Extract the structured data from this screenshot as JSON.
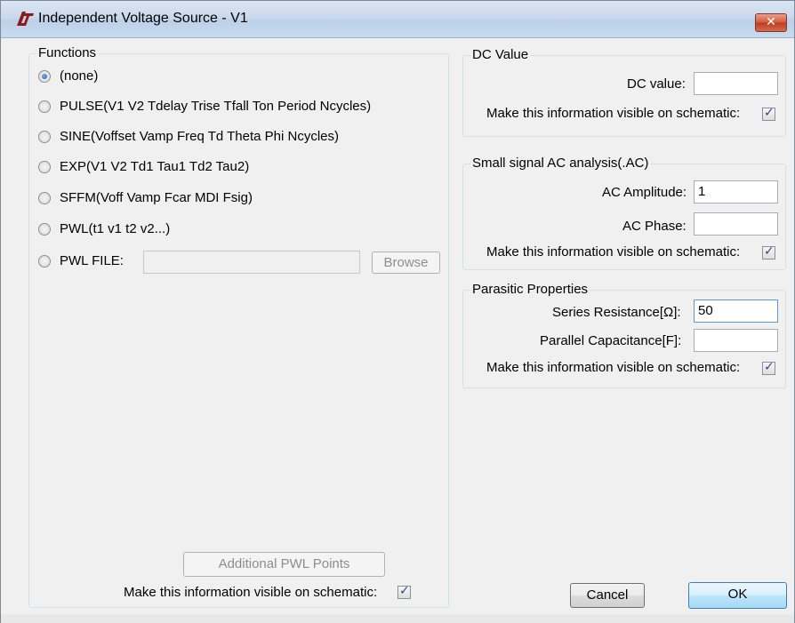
{
  "window": {
    "title": "Independent Voltage Source - V1",
    "close_label": "✕"
  },
  "functions": {
    "legend": "Functions",
    "options": [
      {
        "label": "(none)",
        "checked": true
      },
      {
        "label": "PULSE(V1 V2 Tdelay Trise Tfall Ton Period Ncycles)",
        "checked": false
      },
      {
        "label": "SINE(Voffset Vamp Freq Td Theta Phi Ncycles)",
        "checked": false
      },
      {
        "label": "EXP(V1 V2 Td1 Tau1 Td2 Tau2)",
        "checked": false
      },
      {
        "label": "SFFM(Voff Vamp Fcar MDI Fsig)",
        "checked": false
      },
      {
        "label": "PWL(t1 v1 t2 v2...)",
        "checked": false
      },
      {
        "label": "PWL FILE:",
        "checked": false
      }
    ],
    "pwl_file_value": "",
    "browse_label": "Browse",
    "additional_pwl_label": "Additional PWL Points",
    "visible_label": "Make this information visible on schematic:",
    "visible_checked": true
  },
  "dc": {
    "legend": "DC Value",
    "value_label": "DC value:",
    "value": "",
    "visible_label": "Make this information visible on schematic:",
    "visible_checked": true
  },
  "ac": {
    "legend": "Small signal AC analysis(.AC)",
    "amplitude_label": "AC Amplitude:",
    "amplitude": "1",
    "phase_label": "AC Phase:",
    "phase": "",
    "visible_label": "Make this information visible on schematic:",
    "visible_checked": true
  },
  "parasitic": {
    "legend": "Parasitic Properties",
    "series_label": "Series Resistance[Ω]:",
    "series_value": "50",
    "parallel_label": "Parallel Capacitance[F]:",
    "parallel_value": "",
    "visible_label": "Make this information visible on schematic:",
    "visible_checked": true
  },
  "buttons": {
    "cancel": "Cancel",
    "ok": "OK"
  },
  "colors": {
    "logo": "#8b1a1a",
    "close": "#c94a2e",
    "accent": "#3c7fb1"
  }
}
